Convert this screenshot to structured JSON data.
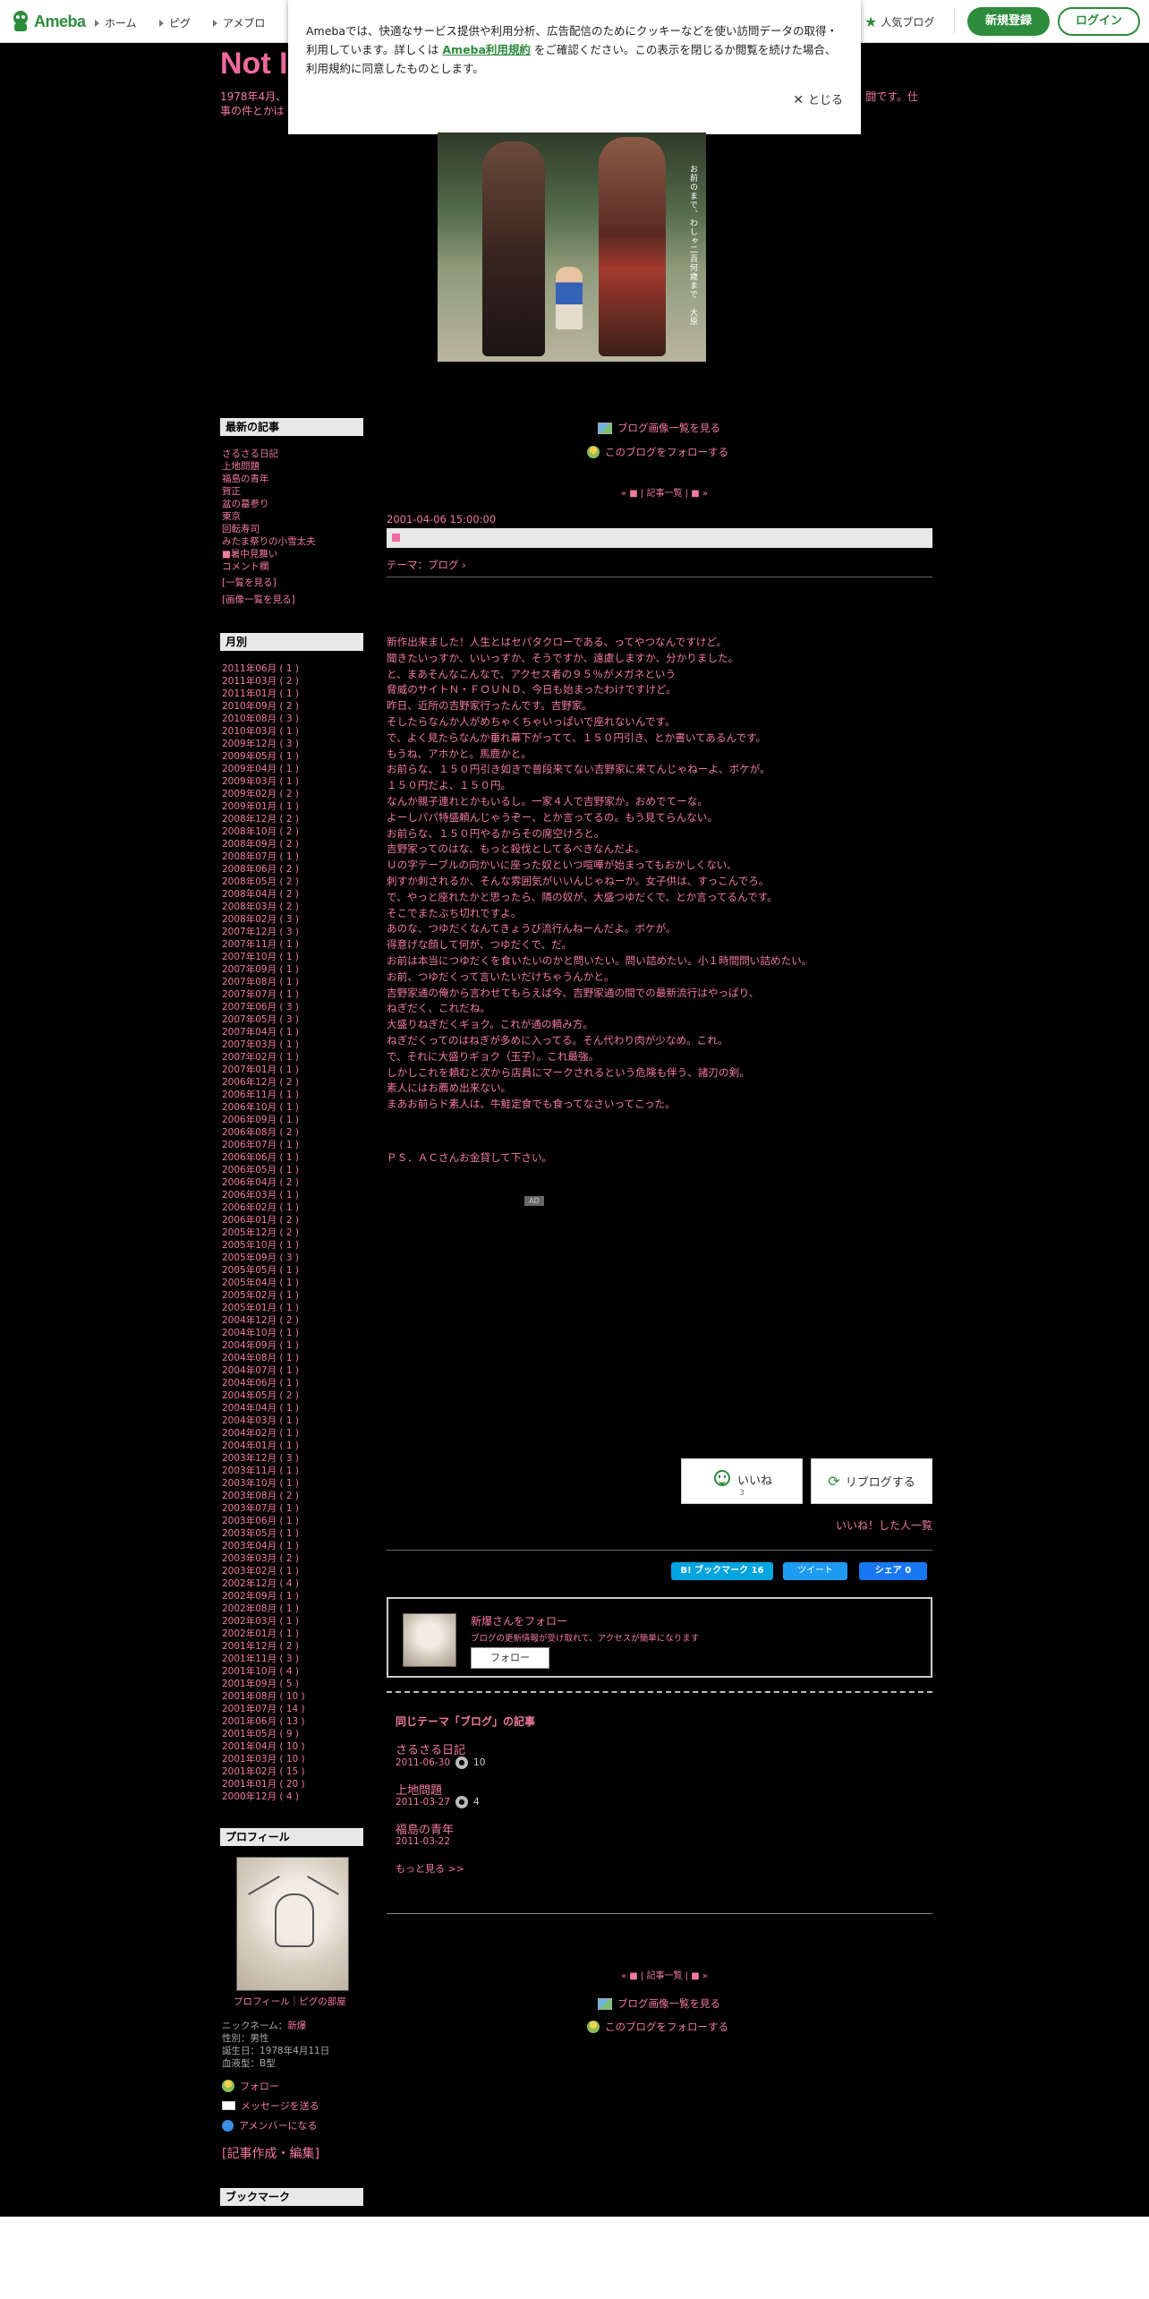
{
  "header": {
    "logo": "Ameba",
    "nav": [
      "ホーム",
      "ピグ",
      "アメブロ"
    ],
    "popular": "人気ブログ",
    "register": "新規登録",
    "login": "ログイン"
  },
  "cookie": {
    "text_before": "Amebaでは、快適なサービス提供や利用分析、広告配信のためにクッキーなどを使い訪問データの取得・利用しています。詳しくは",
    "link": "Ameba利用規約",
    "text_after": "をご確認ください。この表示を閉じるか閲覧を続けた場合、利用規約に同意したものとします。",
    "close": "とじる"
  },
  "blog": {
    "title": "Not I",
    "desc_left": "1978年4月、",
    "desc_right": "闘です。仕",
    "desc_line2": "事の件とかは",
    "photo_caption": "お前のまで、わしゃ二百何歳まで　大原"
  },
  "sidebar": {
    "recent_heading": "最新の記事",
    "recent": [
      "さるさる日記",
      "上地問題",
      "福島の青年",
      "賀正",
      "盆の墓参り",
      "東京",
      "回転寿司",
      "みたま祭りの小雪太夫",
      "■暑中見舞い",
      "コメント欄"
    ],
    "recent_more": "[一覧を見る]",
    "recent_images": "[画像一覧を見る]",
    "monthly_heading": "月別",
    "monthly": [
      "2011年06月 ( 1 )",
      "2011年03月 ( 2 )",
      "2011年01月 ( 1 )",
      "2010年09月 ( 2 )",
      "2010年08月 ( 3 )",
      "2010年03月 ( 1 )",
      "2009年12月 ( 3 )",
      "2009年05月 ( 1 )",
      "2009年04月 ( 1 )",
      "2009年03月 ( 1 )",
      "2009年02月 ( 2 )",
      "2009年01月 ( 1 )",
      "2008年12月 ( 2 )",
      "2008年10月 ( 2 )",
      "2008年09月 ( 2 )",
      "2008年07月 ( 1 )",
      "2008年06月 ( 2 )",
      "2008年05月 ( 2 )",
      "2008年04月 ( 2 )",
      "2008年03月 ( 2 )",
      "2008年02月 ( 3 )",
      "2007年12月 ( 3 )",
      "2007年11月 ( 1 )",
      "2007年10月 ( 1 )",
      "2007年09月 ( 1 )",
      "2007年08月 ( 1 )",
      "2007年07月 ( 1 )",
      "2007年06月 ( 3 )",
      "2007年05月 ( 3 )",
      "2007年04月 ( 1 )",
      "2007年03月 ( 1 )",
      "2007年02月 ( 1 )",
      "2007年01月 ( 1 )",
      "2006年12月 ( 2 )",
      "2006年11月 ( 1 )",
      "2006年10月 ( 1 )",
      "2006年09月 ( 1 )",
      "2006年08月 ( 2 )",
      "2006年07月 ( 1 )",
      "2006年06月 ( 1 )",
      "2006年05月 ( 1 )",
      "2006年04月 ( 2 )",
      "2006年03月 ( 1 )",
      "2006年02月 ( 1 )",
      "2006年01月 ( 2 )",
      "2005年12月 ( 2 )",
      "2005年10月 ( 1 )",
      "2005年09月 ( 3 )",
      "2005年05月 ( 1 )",
      "2005年04月 ( 1 )",
      "2005年02月 ( 1 )",
      "2005年01月 ( 1 )",
      "2004年12月 ( 2 )",
      "2004年10月 ( 1 )",
      "2004年09月 ( 1 )",
      "2004年08月 ( 1 )",
      "2004年07月 ( 1 )",
      "2004年06月 ( 1 )",
      "2004年05月 ( 2 )",
      "2004年04月 ( 1 )",
      "2004年03月 ( 1 )",
      "2004年02月 ( 1 )",
      "2004年01月 ( 1 )",
      "2003年12月 ( 3 )",
      "2003年11月 ( 1 )",
      "2003年10月 ( 1 )",
      "2003年08月 ( 2 )",
      "2003年07月 ( 1 )",
      "2003年06月 ( 1 )",
      "2003年05月 ( 1 )",
      "2003年04月 ( 1 )",
      "2003年03月 ( 2 )",
      "2003年02月 ( 1 )",
      "2002年12月 ( 4 )",
      "2002年09月 ( 1 )",
      "2002年08月 ( 1 )",
      "2002年03月 ( 1 )",
      "2002年01月 ( 1 )",
      "2001年12月 ( 2 )",
      "2001年11月 ( 3 )",
      "2001年10月 ( 4 )",
      "2001年09月 ( 5 )",
      "2001年08月 ( 10 )",
      "2001年07月 ( 14 )",
      "2001年06月 ( 13 )",
      "2001年05月 ( 9 )",
      "2001年04月 ( 10 )",
      "2001年03月 ( 10 )",
      "2001年02月 ( 15 )",
      "2001年01月 ( 20 )",
      "2000年12月 ( 4 )"
    ],
    "profile_heading": "プロフィール",
    "profile_links": "プロフィール｜ピグの部屋",
    "nickname_label": "ニックネーム：",
    "nickname": "新爆",
    "gender": "性別：男性",
    "birthday": "誕生日：1978年4月11日",
    "blood": "血液型：B型",
    "follow": "フォロー",
    "message": "メッセージを送る",
    "amember": "アメンバーになる",
    "edit": "[記事作成・編集]",
    "bookmark_heading": "ブックマーク"
  },
  "main": {
    "image_list": "ブログ画像一覧を見る",
    "follow_blog": "このブログをフォローする",
    "pager": "« ■ | 記事一覧 | ■ »",
    "entry_date": "2001-04-06 15:00:00",
    "entry_title": "■",
    "theme": "テーマ：ブログ",
    "body": [
      "新作出来ました！人生とはセパタクローである、ってやつなんですけど。",
      "聞きたいっすか、いいっすか、そうですか、遠慮しますか、分かりました。",
      "と、まあそんなこんなで、アクセス者の９５％がメガネという",
      "脅威のサイトＮ・ＦＯＵＮＤ、今日も始まったわけですけど。",
      "昨日、近所の吉野家行ったんです。吉野家。",
      "そしたらなんか人がめちゃくちゃいっぱいで座れないんです。",
      "で、よく見たらなんか垂れ幕下がってて、１５０円引き、とか書いてあるんです。",
      "もうね、アホかと。馬鹿かと。",
      "お前らな、１５０円引き如きで普段来てない吉野家に来てんじゃねーよ、ボケが。",
      "１５０円だよ、１５０円。",
      "なんか親子連れとかもいるし。一家４人で吉野家か。おめでてーな。",
      "よーしパパ特盛頼んじゃうぞー、とか言ってるの。もう見てらんない。",
      "お前らな、１５０円やるからその席空けろと。",
      "吉野家ってのはな、もっと殺伐としてるべきなんだよ。",
      "Ｕの字テーブルの向かいに座った奴といつ喧嘩が始まってもおかしくない、",
      "刺すか刺されるか、そんな雰囲気がいいんじゃねーか。女子供は、すっこんでろ。",
      "で、やっと座れたかと思ったら、隣の奴が、大盛つゆだくで、とか言ってるんです。",
      "そこでまたぶち切れですよ。",
      "あのな、つゆだくなんてきょうび流行んねーんだよ。ボケが。",
      "得意げな顔して何が、つゆだくで、だ。",
      "お前は本当につゆだくを食いたいのかと問いたい。問い詰めたい。小１時間問い詰めたい。",
      "お前、つゆだくって言いたいだけちゃうんかと。",
      "吉野家通の俺から言わせてもらえば今、吉野家通の間での最新流行はやっぱり、",
      "ねぎだく、これだね。",
      "大盛りねぎだくギョク。これが通の頼み方。",
      "ねぎだくってのはねぎが多めに入ってる。そん代わり肉が少なめ。これ。",
      "で、それに大盛りギョク（玉子）。これ最強。",
      "しかしこれを頼むと次から店員にマークされるという危険も伴う、諸刃の剣。",
      "素人にはお薦め出来ない。",
      "まあお前らド素人は、牛鮭定食でも食ってなさいってこった。"
    ],
    "ps": "ＰＳ．ＡＣさんお金貸して下さい。",
    "ad": "AD",
    "like_label": "いいね",
    "like_count": "3",
    "reblog": "リブログする",
    "liked_list": "いいね！した人一覧",
    "hatena": "B! ブックマーク 16",
    "tweet": "ツイート",
    "fb": "シェア 0",
    "follow_box_title": "新爆さんをフォロー",
    "follow_box_sub": "ブログの更新情報が受け取れて、アクセスが簡単になります",
    "follow_btn": "フォロー",
    "related_heading": "同じテーマ「ブログ」の記事",
    "related": [
      {
        "title": "さるさる日記",
        "date": "2011-06-30",
        "comments": "10"
      },
      {
        "title": "上地問題",
        "date": "2011-03-27",
        "comments": "4"
      },
      {
        "title": "福島の青年",
        "date": "2011-03-22",
        "comments": ""
      }
    ],
    "related_more": "もっと見る >>"
  },
  "colors": {
    "accent": "#f17a9e",
    "brand_green": "#2d8c3c",
    "background": "#000000"
  }
}
